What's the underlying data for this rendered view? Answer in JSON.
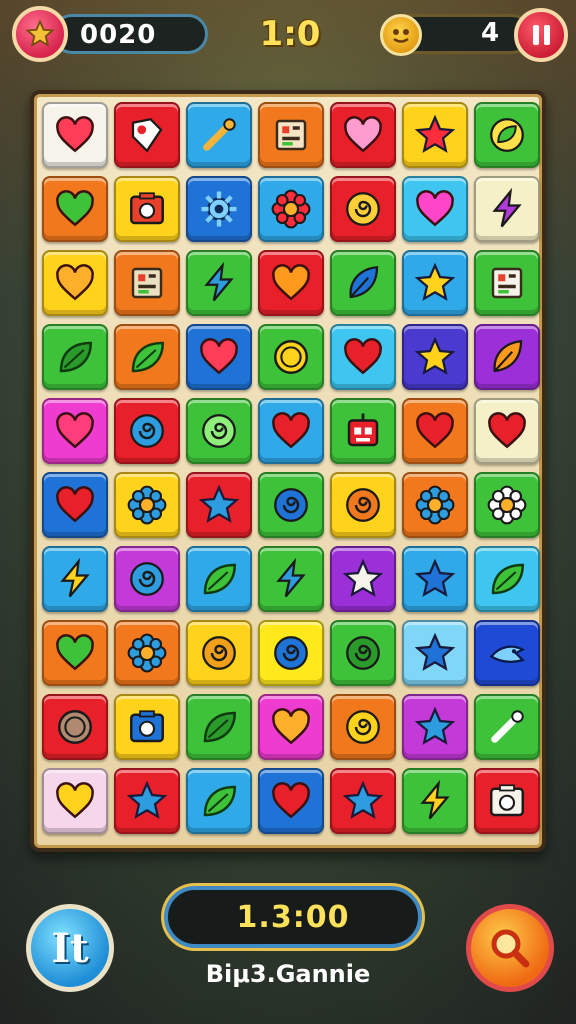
{
  "hud": {
    "score": "0020",
    "center_score": "1:0",
    "lives": "4",
    "score_badge_icon": "star-icon",
    "lives_icon": "coin-face-icon",
    "pause_icon": "pause-icon"
  },
  "board": {
    "rows": [
      [
        {
          "bg": "#f6f3ea",
          "icon": "heart",
          "c": "#ff3d57"
        },
        {
          "bg": "#e8202a",
          "icon": "shield-tag",
          "c": "#ffffff"
        },
        {
          "bg": "#2fa9e8",
          "icon": "wand",
          "c": "#f2b53a"
        },
        {
          "bg": "#f1781c",
          "icon": "card",
          "c": "#f6e4c4"
        },
        {
          "bg": "#e8202a",
          "icon": "heart",
          "c": "#ff9ccf"
        },
        {
          "bg": "#ffd21c",
          "icon": "star",
          "c": "#ff2d3c"
        },
        {
          "bg": "#3ec23a",
          "icon": "leaf-bubble",
          "c": "#ffe24a"
        }
      ],
      [
        {
          "bg": "#f1781c",
          "icon": "heart",
          "c": "#3ec23a"
        },
        {
          "bg": "#ffd21c",
          "icon": "camera",
          "c": "#e8402a"
        },
        {
          "bg": "#1f72d6",
          "icon": "cog-wrench",
          "c": "#7fd0ff"
        },
        {
          "bg": "#2fa9e8",
          "icon": "flower",
          "c": "#ff2d3c"
        },
        {
          "bg": "#e8202a",
          "icon": "swirl",
          "c": "#ffcf3a"
        },
        {
          "bg": "#3ec6f0",
          "icon": "heart",
          "c": "#ff46c8"
        },
        {
          "bg": "#f6f0c8",
          "icon": "bolt",
          "c": "#b13ad8"
        }
      ],
      [
        {
          "bg": "#ffd21c",
          "icon": "heart",
          "c": "#ffb02a"
        },
        {
          "bg": "#f1781c",
          "icon": "card",
          "c": "#e8e0c0"
        },
        {
          "bg": "#3ec23a",
          "icon": "bolt",
          "c": "#2e9de0"
        },
        {
          "bg": "#e8202a",
          "icon": "heart",
          "c": "#ff9a1c"
        },
        {
          "bg": "#3ec23a",
          "icon": "feather",
          "c": "#1f72d6"
        },
        {
          "bg": "#2fa9e8",
          "icon": "star",
          "c": "#ffd21c"
        },
        {
          "bg": "#3ec23a",
          "icon": "card",
          "c": "#f6f3ea"
        }
      ],
      [
        {
          "bg": "#3ec23a",
          "icon": "leaf",
          "c": "#2a9a2a"
        },
        {
          "bg": "#f1781c",
          "icon": "leaf",
          "c": "#3ec23a"
        },
        {
          "bg": "#1f72d6",
          "icon": "heart",
          "c": "#ff3d57"
        },
        {
          "bg": "#3ec23a",
          "icon": "coin",
          "c": "#ffd21c"
        },
        {
          "bg": "#3ec6f0",
          "icon": "heart",
          "c": "#e8202a"
        },
        {
          "bg": "#4a3ad0",
          "icon": "star",
          "c": "#ffd21c"
        },
        {
          "bg": "#9b2fd8",
          "icon": "feather",
          "c": "#ff9a1c"
        }
      ],
      [
        {
          "bg": "#ee3bd0",
          "icon": "heart",
          "c": "#ff3d7a"
        },
        {
          "bg": "#e8202a",
          "icon": "swirl",
          "c": "#2e9de0"
        },
        {
          "bg": "#3ec23a",
          "icon": "swirl",
          "c": "#8ef07a"
        },
        {
          "bg": "#2fa9e8",
          "icon": "heart",
          "c": "#e8202a"
        },
        {
          "bg": "#3ec23a",
          "icon": "robot",
          "c": "#e8202a"
        },
        {
          "bg": "#f1781c",
          "icon": "heart",
          "c": "#e8202a"
        },
        {
          "bg": "#f6f0c8",
          "icon": "heart",
          "c": "#e8202a"
        }
      ],
      [
        {
          "bg": "#1f72d6",
          "icon": "heart",
          "c": "#e8202a"
        },
        {
          "bg": "#ffd21c",
          "icon": "flower",
          "c": "#2e9de0"
        },
        {
          "bg": "#e8202a",
          "icon": "star",
          "c": "#2e9de0"
        },
        {
          "bg": "#3ec23a",
          "icon": "swirl",
          "c": "#1f72d6"
        },
        {
          "bg": "#ffd21c",
          "icon": "swirl",
          "c": "#f1781c"
        },
        {
          "bg": "#f1781c",
          "icon": "flower",
          "c": "#2e9de0"
        },
        {
          "bg": "#3ec23a",
          "icon": "flower",
          "c": "#ffffff"
        }
      ],
      [
        {
          "bg": "#2fa9e8",
          "icon": "bolt",
          "c": "#ffd21c"
        },
        {
          "bg": "#c43ad8",
          "icon": "swirl",
          "c": "#2e9de0"
        },
        {
          "bg": "#2fa9e8",
          "icon": "leaf",
          "c": "#3ec23a"
        },
        {
          "bg": "#3ec23a",
          "icon": "bolt",
          "c": "#2e9de0"
        },
        {
          "bg": "#9b2fd8",
          "icon": "star",
          "c": "#f6f3ea"
        },
        {
          "bg": "#2fa9e8",
          "icon": "star",
          "c": "#1f72d6"
        },
        {
          "bg": "#3ec6f0",
          "icon": "leaf",
          "c": "#3ec23a"
        }
      ],
      [
        {
          "bg": "#f1781c",
          "icon": "heart",
          "c": "#3ec23a"
        },
        {
          "bg": "#f1781c",
          "icon": "flower",
          "c": "#2e9de0"
        },
        {
          "bg": "#ffd21c",
          "icon": "swirl",
          "c": "#f1a01c"
        },
        {
          "bg": "#ffe81c",
          "icon": "swirl",
          "c": "#1f72d6"
        },
        {
          "bg": "#3ec23a",
          "icon": "swirl",
          "c": "#2a9a2a"
        },
        {
          "bg": "#7fd6f6",
          "icon": "star",
          "c": "#1f72d6"
        },
        {
          "bg": "#1f4ad6",
          "icon": "bird",
          "c": "#7fd0ff"
        }
      ],
      [
        {
          "bg": "#e8202a",
          "icon": "coin",
          "c": "#b08a70"
        },
        {
          "bg": "#ffd21c",
          "icon": "camera",
          "c": "#1f72d6"
        },
        {
          "bg": "#3ec23a",
          "icon": "leaf",
          "c": "#2a9a2a"
        },
        {
          "bg": "#ee3bd0",
          "icon": "heart",
          "c": "#ffb02a"
        },
        {
          "bg": "#f1781c",
          "icon": "swirl",
          "c": "#ffd21c"
        },
        {
          "bg": "#c43ad8",
          "icon": "star",
          "c": "#2e9de0"
        },
        {
          "bg": "#3ec23a",
          "icon": "wand",
          "c": "#ffffff"
        }
      ],
      [
        {
          "bg": "#f6d6ea",
          "icon": "heart",
          "c": "#ffd21c"
        },
        {
          "bg": "#e8202a",
          "icon": "star",
          "c": "#2e9de0"
        },
        {
          "bg": "#2fa9e8",
          "icon": "leaf",
          "c": "#3ec23a"
        },
        {
          "bg": "#1f72d6",
          "icon": "heart",
          "c": "#e8202a"
        },
        {
          "bg": "#e8202a",
          "icon": "star",
          "c": "#2e9de0"
        },
        {
          "bg": "#3ec23a",
          "icon": "bolt",
          "c": "#ffd21c"
        },
        {
          "bg": "#e8202a",
          "icon": "camera",
          "c": "#f6f3ea"
        }
      ]
    ]
  },
  "footer": {
    "left_button_label": "It",
    "timer": "1.3:00",
    "label": "Biμ3.Gannie",
    "right_button_icon": "magnifier-icon"
  }
}
